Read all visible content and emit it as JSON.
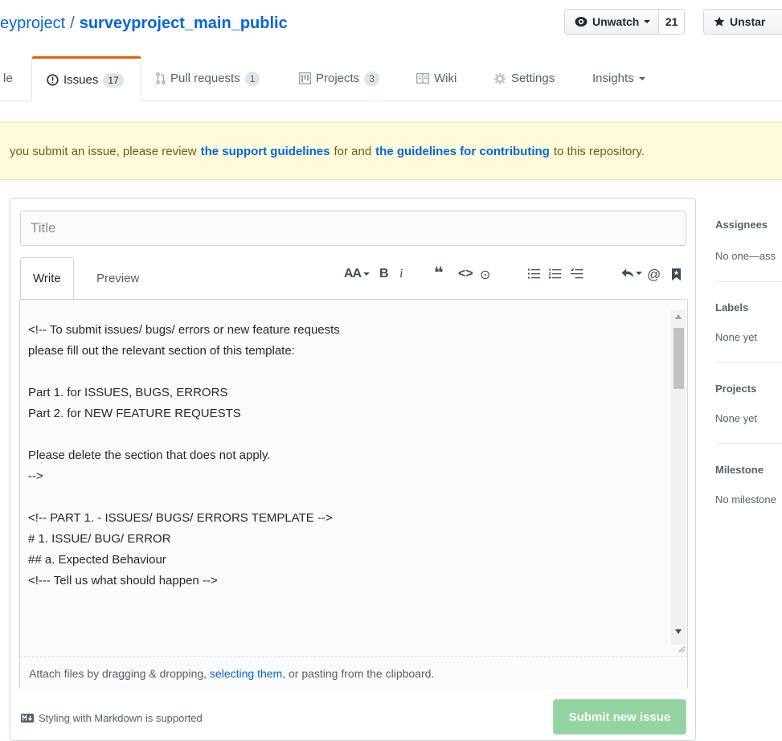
{
  "repo": {
    "owner": "eyproject",
    "separator": "/",
    "name": "surveyproject_main_public"
  },
  "actions": {
    "watch_label": "Unwatch",
    "watch_count": "21",
    "star_label": "Unstar"
  },
  "tabs": [
    {
      "label": "le"
    },
    {
      "label": "Issues",
      "count": "17"
    },
    {
      "label": "Pull requests",
      "count": "1"
    },
    {
      "label": "Projects",
      "count": "3"
    },
    {
      "label": "Wiki"
    },
    {
      "label": "Settings"
    },
    {
      "label": "Insights"
    }
  ],
  "flash": {
    "part1": "you submit an issue, please review",
    "link1": "the support guidelines",
    "part2": "for and",
    "link2": "the guidelines for contributing",
    "part3": "to this repository."
  },
  "form": {
    "title_placeholder": "Title",
    "tab_write": "Write",
    "tab_preview": "Preview",
    "toolbar": {
      "header": "AA",
      "bold": "B",
      "italic": "i",
      "quote": "❝",
      "code": "<>",
      "link": "⊙",
      "mention": "@"
    },
    "template_text": "<!-- To submit issues/ bugs/ errors or new feature requests\nplease fill out the relevant section of this template:\n\nPart 1. for ISSUES, BUGS, ERRORS\nPart 2. for NEW FEATURE REQUESTS\n\nPlease delete the section that does not apply.\n-->\n\n<!-- PART 1. - ISSUES/ BUGS/ ERRORS TEMPLATE -->\n# 1. ISSUE/ BUG/ ERROR\n## a. Expected Behaviour\n<!--- Tell us what should happen -->",
    "attach_pre": "Attach files by dragging & dropping,",
    "attach_link": "selecting them",
    "attach_post": ", or pasting from the clipboard.",
    "markdown_note": "Styling with Markdown is supported",
    "submit_label": "Submit new issue"
  },
  "sidebar": [
    {
      "heading": "Assignees",
      "value": "No one—ass"
    },
    {
      "heading": "Labels",
      "value": "None yet"
    },
    {
      "heading": "Projects",
      "value": "None yet"
    },
    {
      "heading": "Milestone",
      "value": "No milestone"
    }
  ],
  "colors": {
    "accent": "#0366d6",
    "tab_highlight": "#e36209",
    "flash_bg": "#fffbdd",
    "submit_bg": "#94d3a2"
  }
}
